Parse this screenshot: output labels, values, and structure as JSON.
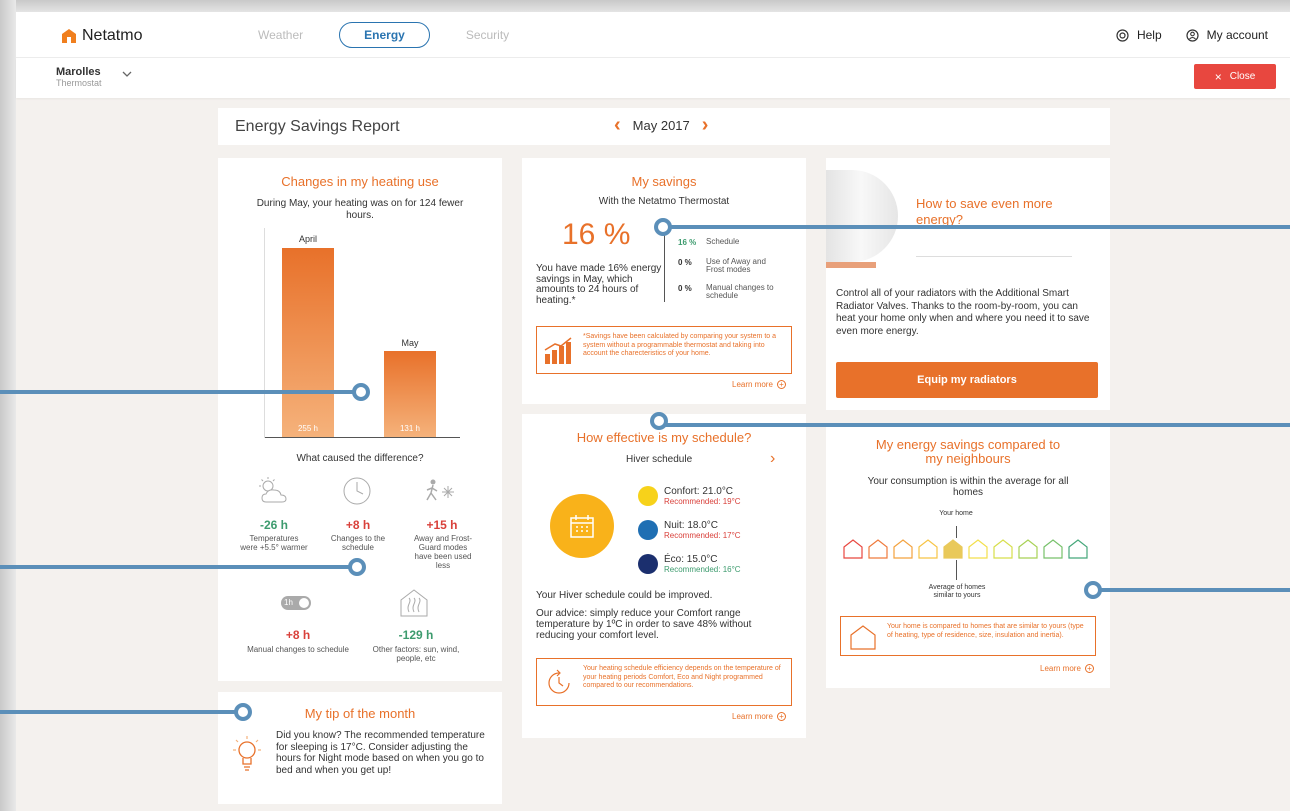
{
  "app": {
    "brand": "Netatmo",
    "brand_color": "#f07f1e"
  },
  "nav": {
    "tabs": [
      {
        "label": "Weather"
      },
      {
        "label": "Energy",
        "active": true
      },
      {
        "label": "Security"
      }
    ]
  },
  "top_right": {
    "help": "Help",
    "account": "My account"
  },
  "location": {
    "name": "Marolles",
    "device": "Thermostat"
  },
  "close_label": "Close",
  "report": {
    "title": "Energy Savings Report",
    "month": "May 2017"
  },
  "heating_use": {
    "title": "Changes in my heating use",
    "summary": "During May, your heating was on for 124 fewer hours.",
    "bars": [
      {
        "label": "April",
        "value_label": "255 h",
        "value": 255
      },
      {
        "label": "May",
        "value_label": "131 h",
        "value": 131
      }
    ],
    "cause_title": "What caused the difference?",
    "causes": [
      {
        "icon": "weather-icon",
        "value": "-26 h",
        "label": "Temperatures were +5.5° warmer",
        "color": "green"
      },
      {
        "icon": "clock-icon",
        "value": "+8 h",
        "label": "Changes to the schedule",
        "color": "red"
      },
      {
        "icon": "away-frost-icon",
        "value": "+15 h",
        "label": "Away and Frost-Guard modes have been used less",
        "color": "red"
      },
      {
        "icon": "manual-toggle-icon",
        "value": "+8 h",
        "label": "Manual changes to schedule",
        "color": "red"
      },
      {
        "icon": "house-heat-icon",
        "value": "-129 h",
        "label": "Other factors: sun, wind, people, etc",
        "color": "green"
      }
    ],
    "toggle_text": "1h"
  },
  "tip": {
    "title": "My tip of the month",
    "text": "Did you know? The recommended temperature for sleeping is 17°C. Consider adjusting the hours for Night mode based on when you go to bed and when you get up!"
  },
  "savings": {
    "title": "My savings",
    "subtitle": "With the Netatmo Thermostat",
    "big_value": "16 %",
    "description": "You have made 16% energy savings in May, which amounts to 24 hours of heating.*",
    "breakdown": [
      {
        "value": "16 %",
        "label": "Schedule"
      },
      {
        "value": "0 %",
        "label": "Use of Away and Frost modes"
      },
      {
        "value": "0 %",
        "label": "Manual changes to schedule"
      }
    ],
    "note": "*Savings have been calculated by comparing your system to a system without a programmable thermostat and taking into account the charecteristics of your home.",
    "learn_more": "Learn more"
  },
  "schedule": {
    "title": "How effective is my schedule?",
    "name": "Hiver schedule",
    "modes": [
      {
        "label": "Confort: 21.0°C",
        "rec": "Recommended: 19°C",
        "color": "#f7d21a",
        "rec_color": "red"
      },
      {
        "label": "Nuit: 18.0°C",
        "rec": "Recommended: 17°C",
        "color": "#1f6fb3",
        "rec_color": "red"
      },
      {
        "label": "Éco: 15.0°C",
        "rec": "Recommended: 16°C",
        "color": "#1b2f6e",
        "rec_color": "green"
      }
    ],
    "verdict": "Your Hiver schedule could be improved.",
    "advice": "Our advice: simply reduce your Comfort range temperature by 1ºC in order to save 48% without reducing your comfort level.",
    "note": "Your heating schedule efficiency depends on the temperature of your heating periods Comfort, Eco and Night programmed compared to our recommendations.",
    "learn_more": "Learn more"
  },
  "promo": {
    "title": "How to save even more energy?",
    "text": "Control all of your radiators with the Additional Smart Radiator Valves. Thanks to the room-by-room, you can heat your home only when and where you need it to save even more energy.",
    "button": "Equip my radiators"
  },
  "neighbours": {
    "title": "My energy savings compared to my neighbours",
    "subtitle": "Your consumption is within the average for all homes",
    "your_home": "Your home",
    "average_label": "Average of homes similar to yours",
    "note": "Your home is compared to homes that are similar to yours (type of heating, type of residence, size, insulation and inertia).",
    "learn_more": "Learn more",
    "house_colors": [
      "#e8473f",
      "#ef7a3c",
      "#f3a23e",
      "#f7c445",
      "#e9c95a",
      "#f3df4b",
      "#d7df4a",
      "#a8d155",
      "#77c16a",
      "#45a77a"
    ]
  }
}
